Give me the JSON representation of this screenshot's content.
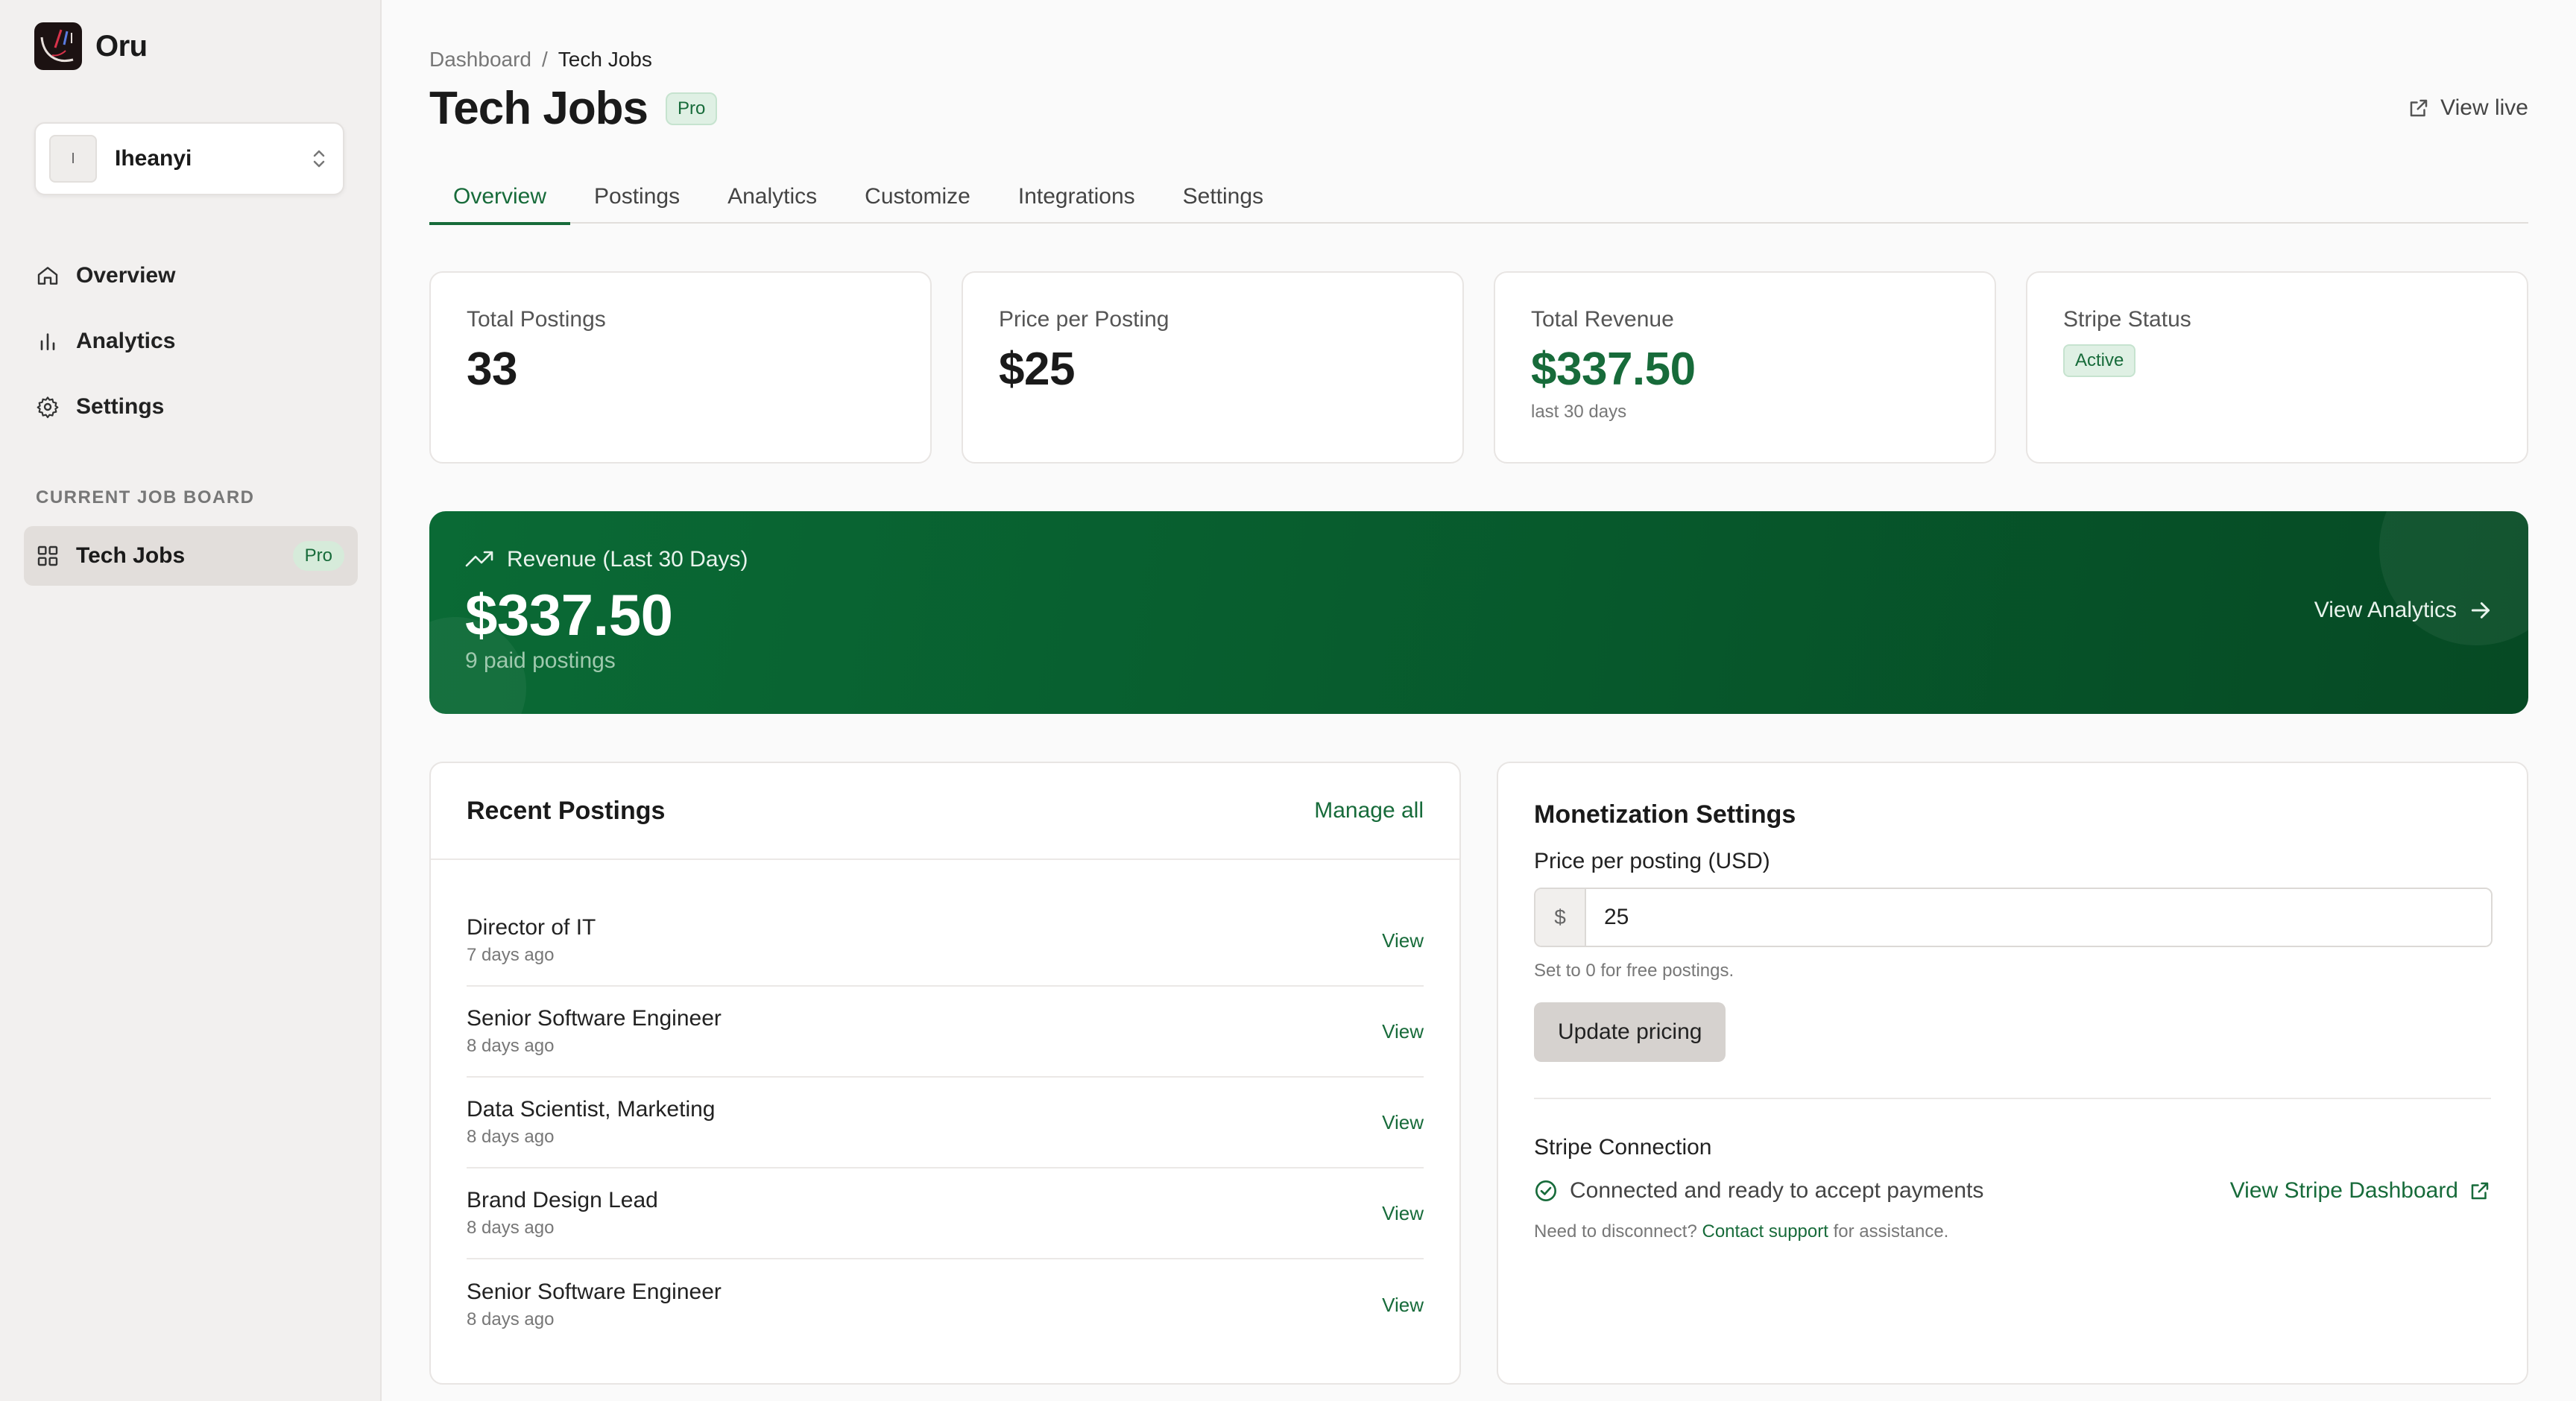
{
  "brand": {
    "name": "Oru"
  },
  "workspace": {
    "avatar_letter": "I",
    "name": "Iheanyi"
  },
  "nav": [
    {
      "label": "Overview",
      "icon": "home-icon"
    },
    {
      "label": "Analytics",
      "icon": "bar-chart-icon"
    },
    {
      "label": "Settings",
      "icon": "gear-icon"
    }
  ],
  "current_board": {
    "section_label": "CURRENT JOB BOARD",
    "name": "Tech Jobs",
    "badge": "Pro"
  },
  "breadcrumb": {
    "root": "Dashboard",
    "separator": "/",
    "current": "Tech Jobs"
  },
  "page": {
    "title": "Tech Jobs",
    "badge": "Pro",
    "view_live": "View live"
  },
  "tabs": [
    "Overview",
    "Postings",
    "Analytics",
    "Customize",
    "Integrations",
    "Settings"
  ],
  "active_tab": "Overview",
  "stats": {
    "total_postings": {
      "label": "Total Postings",
      "value": "33"
    },
    "price_per_posting": {
      "label": "Price per Posting",
      "value": "$25"
    },
    "total_revenue": {
      "label": "Total Revenue",
      "value": "$337.50",
      "sub": "last 30 days"
    },
    "stripe_status": {
      "label": "Stripe Status",
      "value": "Active"
    }
  },
  "revenue_banner": {
    "label": "Revenue (Last 30 Days)",
    "value": "$337.50",
    "sub": "9 paid postings",
    "link": "View Analytics"
  },
  "recent_postings": {
    "title": "Recent Postings",
    "manage_link": "Manage all",
    "view_label": "View",
    "items": [
      {
        "title": "Director of IT",
        "date": "7 days ago"
      },
      {
        "title": "Senior Software Engineer",
        "date": "8 days ago"
      },
      {
        "title": "Data Scientist, Marketing",
        "date": "8 days ago"
      },
      {
        "title": "Brand Design Lead",
        "date": "8 days ago"
      },
      {
        "title": "Senior Software Engineer",
        "date": "8 days ago"
      }
    ]
  },
  "monetization": {
    "title": "Monetization Settings",
    "price_label": "Price per posting (USD)",
    "currency_prefix": "$",
    "price_value": "25",
    "help": "Set to 0 for free postings.",
    "update_button": "Update pricing",
    "stripe_title": "Stripe Connection",
    "stripe_status": "Connected and ready to accept payments",
    "stripe_link": "View Stripe Dashboard",
    "disconnect_prefix": "Need to disconnect?",
    "disconnect_link": "Contact support",
    "disconnect_suffix": "for assistance."
  },
  "colors": {
    "accent": "#176b3a",
    "banner_start": "#0a6a35",
    "banner_end": "#064a24",
    "sidebar_bg": "#f2f0ef"
  }
}
